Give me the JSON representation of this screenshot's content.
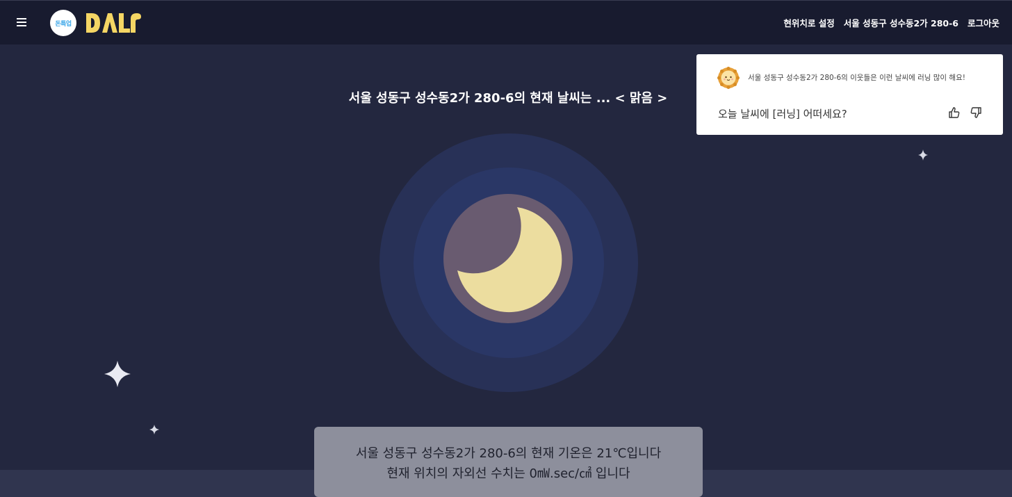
{
  "header": {
    "logo_badge_text": "돈특업",
    "nav": {
      "set_location_label": "현위치로 설정",
      "address_label": "서울 성동구 성수동2가 280-6",
      "logout_label": "로그아웃"
    }
  },
  "main": {
    "headline": "서울 성동구 성수동2가 280-6의 현재 날씨는 ... < 맑음 >",
    "info": {
      "temperature_line": "서울 성동구 성수동2가 280-6의 현재 기온은 21℃입니다",
      "uv_line": "현재 위치의 자외선 수치는 0㎽.sec/㎠ 입니다"
    }
  },
  "popup": {
    "neighbor_text": "서울 성동구 성수동2가 280-6의 이웃들은 이런 날씨에 러닝 많이 해요!",
    "question": "오늘 날씨에 [러닝] 어떠세요?"
  },
  "icons": {
    "menu": "hamburger-menu-icon",
    "weather": "crescent-moon-icon",
    "mascot": "sun-mascot-icon",
    "like": "thumbs-up-icon",
    "dislike": "thumbs-down-icon"
  },
  "colors": {
    "background": "#23273f",
    "topbar": "#181b2f",
    "logo_yellow": "#f5d664",
    "moon": "#ecdd9f"
  }
}
